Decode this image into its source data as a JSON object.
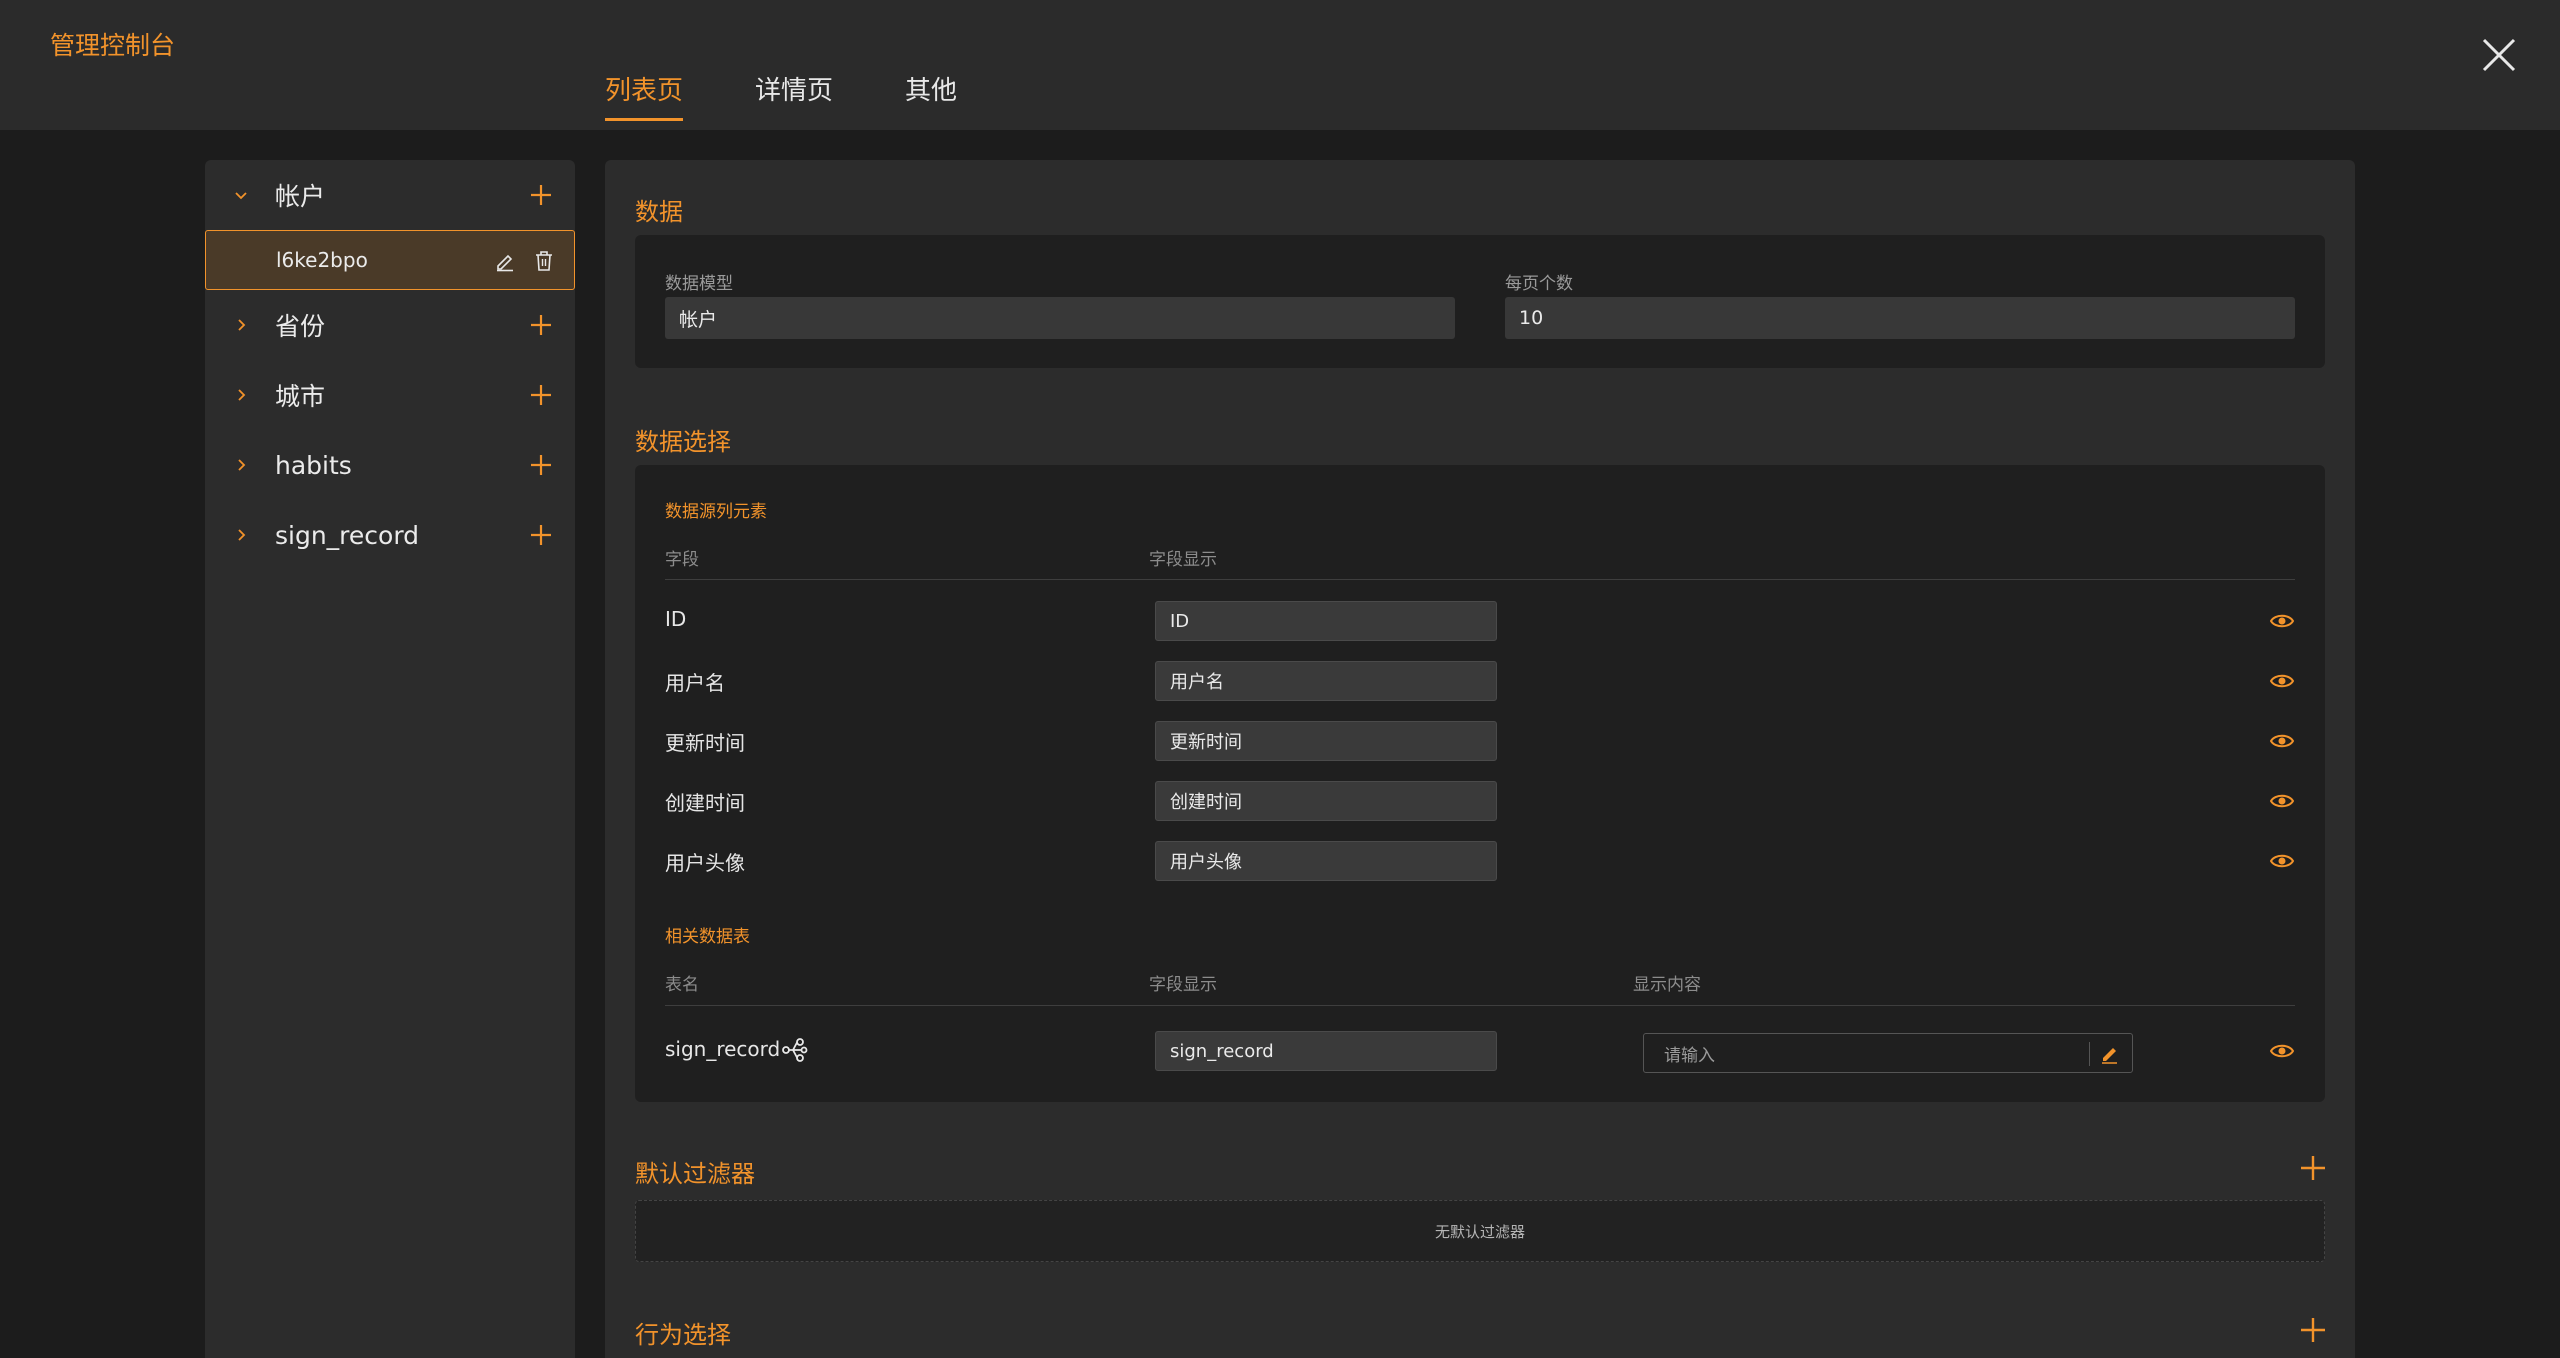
{
  "app": {
    "title": "管理控制台"
  },
  "tabs": [
    {
      "label": "列表页",
      "active": true
    },
    {
      "label": "详情页",
      "active": false
    },
    {
      "label": "其他",
      "active": false
    }
  ],
  "sidebar": {
    "items": [
      {
        "label": "帐户",
        "expanded": true,
        "children": [
          {
            "label": "l6ke2bpo",
            "selected": true
          }
        ]
      },
      {
        "label": "省份",
        "expanded": false
      },
      {
        "label": "城市",
        "expanded": false
      },
      {
        "label": "habits",
        "expanded": false
      },
      {
        "label": "sign_record",
        "expanded": false
      }
    ]
  },
  "data_section": {
    "title": "数据",
    "model_label": "数据模型",
    "model_value": "帐户",
    "page_size_label": "每页个数",
    "page_size_value": "10"
  },
  "selection_section": {
    "title": "数据选择",
    "source_title": "数据源列元素",
    "col_field": "字段",
    "col_display": "字段显示",
    "rows": [
      {
        "field": "ID",
        "display": "ID"
      },
      {
        "field": "用户名",
        "display": "用户名"
      },
      {
        "field": "更新时间",
        "display": "更新时间"
      },
      {
        "field": "创建时间",
        "display": "创建时间"
      },
      {
        "field": "用户头像",
        "display": "用户头像"
      }
    ],
    "related_title": "相关数据表",
    "col_table": "表名",
    "col_table_display": "字段显示",
    "col_content": "显示内容",
    "related_rows": [
      {
        "table": "sign_record",
        "display": "sign_record",
        "content_placeholder": "请输入"
      }
    ]
  },
  "filter_section": {
    "title": "默认过滤器",
    "empty_text": "无默认过滤器"
  },
  "action_section": {
    "title": "行为选择"
  },
  "colors": {
    "accent": "#f2932b",
    "background": "#1c1c1c",
    "panel": "#2c2c2c",
    "card": "#1f1f1f"
  }
}
